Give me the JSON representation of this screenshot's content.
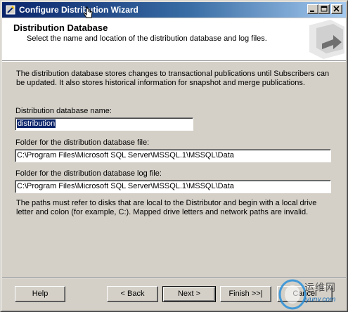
{
  "window": {
    "title": "Configure Distribution Wizard"
  },
  "header": {
    "title": "Distribution Database",
    "subtitle": "Select the name and location of the distribution database and log files."
  },
  "body": {
    "intro": "The distribution database stores changes to transactional publications until Subscribers can be updated. It also stores historical information for snapshot and merge publications.",
    "db_name_label": "Distribution database name:",
    "db_name_value": "distribution",
    "db_folder_label": "Folder for the distribution database file:",
    "db_folder_value": "C:\\Program Files\\Microsoft SQL Server\\MSSQL.1\\MSSQL\\Data",
    "log_folder_label": "Folder for the distribution database log file:",
    "log_folder_value": "C:\\Program Files\\Microsoft SQL Server\\MSSQL.1\\MSSQL\\Data",
    "note": "The paths must refer to disks that are local to the Distributor and begin with a local drive letter and colon (for example, C:). Mapped drive letters and network paths are invalid."
  },
  "buttons": {
    "help": "Help",
    "back": "< Back",
    "next": "Next >",
    "finish": "Finish >>|",
    "cancel": "Cancel"
  },
  "watermark": {
    "text": "运维网",
    "url": "iyunv.com"
  },
  "colors": {
    "titlebar_start": "#0a246a",
    "titlebar_end": "#a6caf0",
    "dialog_face": "#d4d0c8",
    "selection": "#0a246a"
  }
}
